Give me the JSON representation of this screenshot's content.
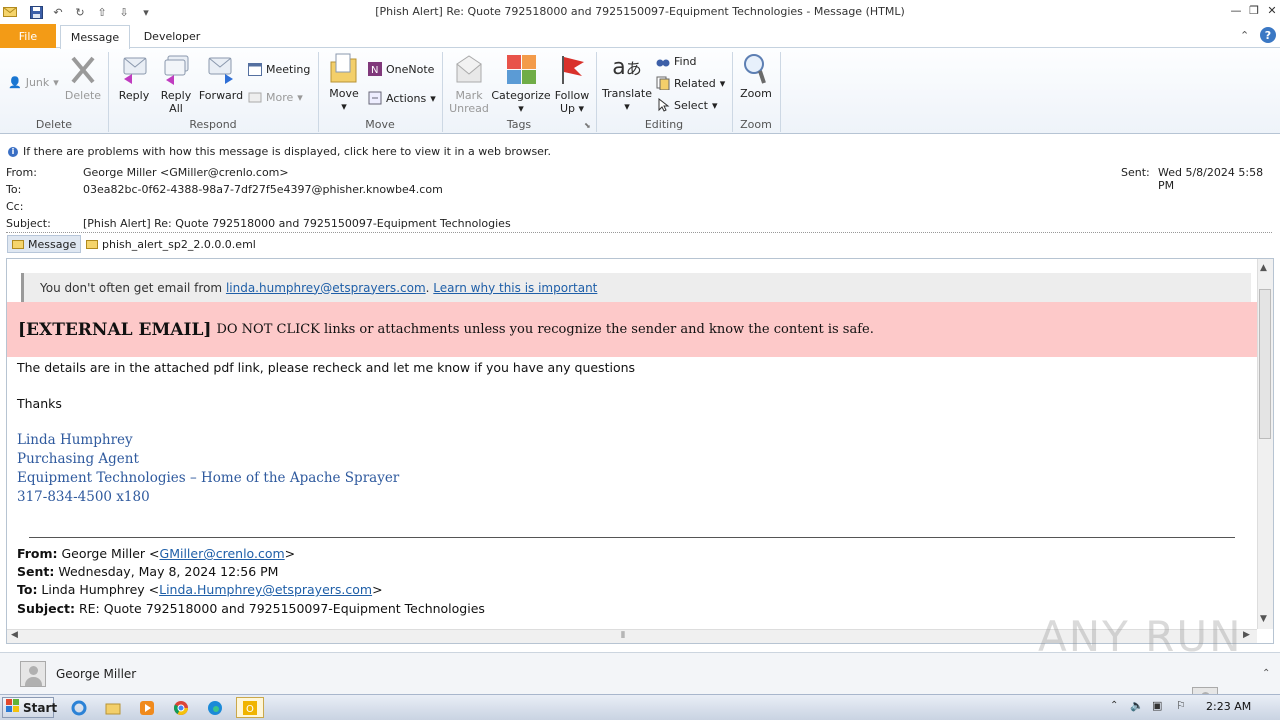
{
  "window": {
    "title": "[Phish Alert] Re: Quote 792518000 and 7925150097-Equipment Technologies  -  Message (HTML)"
  },
  "tabs": {
    "file": "File",
    "message": "Message",
    "developer": "Developer"
  },
  "ribbon": {
    "delete_group": {
      "label": "Delete",
      "junk": "Junk",
      "delete": "Delete"
    },
    "respond_group": {
      "label": "Respond",
      "reply": "Reply",
      "reply_all_1": "Reply",
      "reply_all_2": "All",
      "forward": "Forward",
      "meeting": "Meeting",
      "more": "More"
    },
    "move_group": {
      "label": "Move",
      "move": "Move",
      "onenote": "OneNote",
      "actions": "Actions"
    },
    "tags_group": {
      "label": "Tags",
      "mark_unread_1": "Mark",
      "mark_unread_2": "Unread",
      "categorize": "Categorize",
      "follow_up_1": "Follow",
      "follow_up_2": "Up"
    },
    "editing_group": {
      "label": "Editing",
      "translate": "Translate",
      "find": "Find",
      "related": "Related",
      "select": "Select"
    },
    "zoom_group": {
      "label": "Zoom",
      "zoom": "Zoom"
    }
  },
  "header": {
    "info": "If there are problems with how this message is displayed, click here to view it in a web browser.",
    "from_label": "From:",
    "from": "George Miller <GMiller@crenlo.com>",
    "to_label": "To:",
    "to": "03ea82bc-0f62-4388-98a7-7df27f5e4397@phisher.knowbe4.com",
    "cc_label": "Cc:",
    "subject_label": "Subject:",
    "subject": "[Phish Alert] Re: Quote 792518000 and 7925150097-Equipment Technologies",
    "sent_label": "Sent:",
    "sent": "Wed 5/8/2024 5:58 PM"
  },
  "attachments": {
    "message_tab": "Message",
    "file": "phish_alert_sp2_2.0.0.0.eml"
  },
  "body": {
    "caution_prefix": "You don't often get email from ",
    "caution_email": "linda.humphrey@etsprayers.com",
    "caution_sep": ". ",
    "caution_link": "Learn why this is important",
    "banner_bold": "[EXTERNAL EMAIL]",
    "banner_text": "DO NOT CLICK links or attachments unless you recognize the sender and know the content is safe.",
    "line1": "The details are in the attached pdf link, please recheck and let me know if you have any questions",
    "thanks": "Thanks",
    "sig_name": "Linda Humphrey",
    "sig_title": "Purchasing Agent",
    "sig_company": "Equipment Technologies – Home of the Apache Sprayer",
    "sig_phone": "317-834-4500 x180",
    "fwd_from_label": "From:",
    "fwd_from_name": " George Miller <",
    "fwd_from_email": "GMiller@crenlo.com",
    "fwd_from_end": ">",
    "fwd_sent_label": "Sent:",
    "fwd_sent": " Wednesday, May 8, 2024 12:56 PM",
    "fwd_to_label": "To:",
    "fwd_to_name": " Linda Humphrey <",
    "fwd_to_email": "Linda.Humphrey@etsprayers.com",
    "fwd_to_end": ">",
    "fwd_subject_label": "Subject:",
    "fwd_subject": " RE: Quote 792518000 and 7925150097-Equipment Technologies"
  },
  "people_pane": {
    "name": "George Miller"
  },
  "taskbar": {
    "start": "Start",
    "time": "2:23 AM"
  },
  "watermark": "ANY RUN"
}
